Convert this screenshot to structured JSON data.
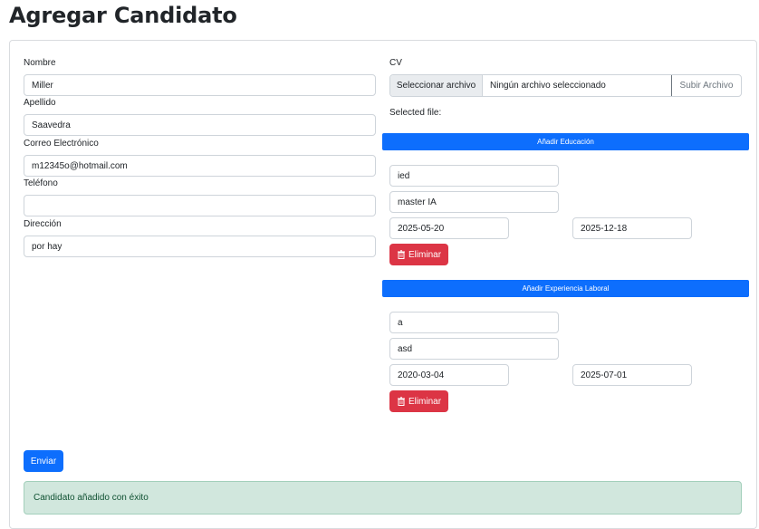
{
  "page": {
    "title": "Agregar Candidato"
  },
  "form": {
    "nombre": {
      "label": "Nombre",
      "value": "Miller"
    },
    "apellido": {
      "label": "Apellido",
      "value": "Saavedra"
    },
    "correo": {
      "label": "Correo Electrónico",
      "value": "m12345o@hotmail.com"
    },
    "telefono": {
      "label": "Teléfono",
      "value": ""
    },
    "direccion": {
      "label": "Dirección",
      "value": "por hay"
    }
  },
  "cv": {
    "label": "CV",
    "choose_label": "Seleccionar archivo",
    "file_status": "Ningún archivo seleccionado",
    "upload_label": "Subir Archivo",
    "selected_label": "Selected file:"
  },
  "education": {
    "add_label": "Añadir Educación",
    "entries": [
      {
        "institution": "ied",
        "title": "master IA",
        "start": "2025-05-20",
        "end": "2025-12-18",
        "delete_label": "Eliminar"
      }
    ]
  },
  "experience": {
    "add_label": "Añadir Experiencia Laboral",
    "entries": [
      {
        "company": "a",
        "position": "asd",
        "start": "2020-03-04",
        "end": "2025-07-01",
        "delete_label": "Eliminar"
      }
    ]
  },
  "submit_label": "Enviar",
  "alert": {
    "message": "Candidato añadido con éxito"
  },
  "colors": {
    "primary": "#0d6efd",
    "danger": "#dc3545",
    "success_bg": "#d1e7dd"
  },
  "icons": {
    "delete": "trash-icon"
  }
}
